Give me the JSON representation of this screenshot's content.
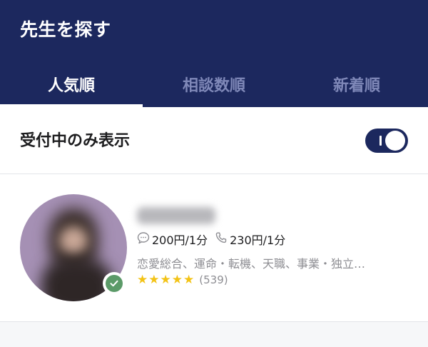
{
  "header": {
    "title": "先生を探す",
    "background_color": "#1c285e"
  },
  "tabs": [
    {
      "label": "人気順",
      "active": true
    },
    {
      "label": "相談数順",
      "active": false
    },
    {
      "label": "新着順",
      "active": false
    }
  ],
  "filter": {
    "label": "受付中のみ表示",
    "toggle_on": true
  },
  "counselors": [
    {
      "name": "",
      "verified": true,
      "chat_price": "200円/1分",
      "phone_price": "230円/1分",
      "categories": "恋愛総合、運命・転機、天職、事業・独立…",
      "rating_stars": 5,
      "review_count": "(539)",
      "icons": {
        "chat": "chat-bubble-icon",
        "phone": "phone-icon",
        "verified": "checkmark-icon"
      }
    }
  ],
  "colors": {
    "accent": "#1c285e",
    "inactive_tab": "#7f88b8",
    "star": "#f3c316",
    "verified": "#5b9a68",
    "subtext": "#8e8e93"
  }
}
